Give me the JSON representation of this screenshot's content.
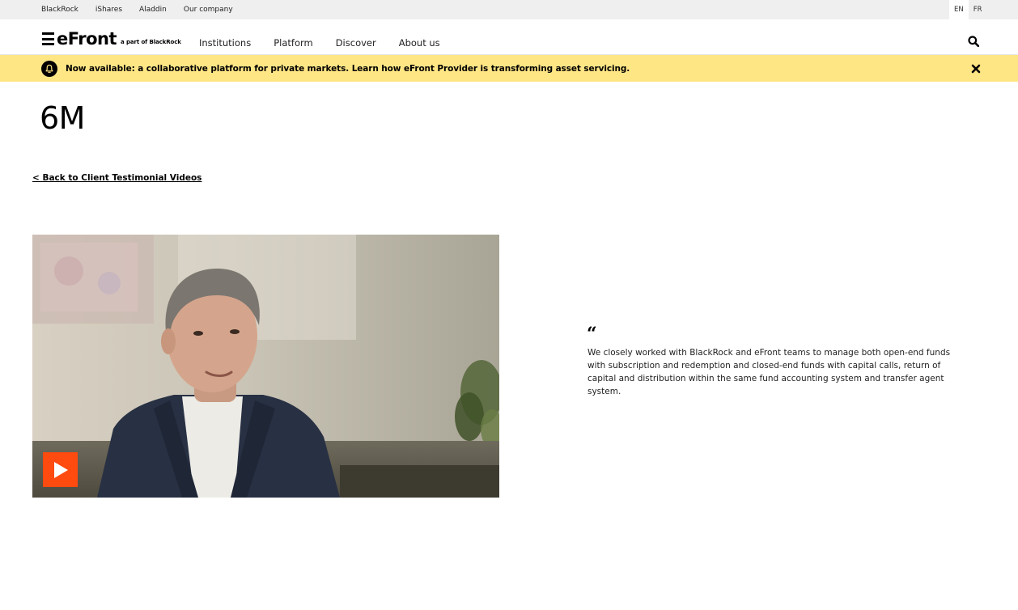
{
  "utility_bar": {
    "links": [
      "BlackRock",
      "iShares",
      "Aladdin",
      "Our company"
    ],
    "languages": [
      "EN",
      "FR"
    ],
    "active_language": "EN"
  },
  "header": {
    "logo_text": "eFront",
    "logo_sub": "a part of BlackRock",
    "nav": [
      "Institutions",
      "Platform",
      "Discover",
      "About us"
    ],
    "search_icon": "search-icon"
  },
  "banner": {
    "icon": "bell-icon",
    "text": "Now available: a collaborative platform for private markets. Learn how eFront Provider is transforming asset servicing.",
    "close_icon": "close-icon"
  },
  "content": {
    "title": "6M",
    "back_link": "< Back to Client Testimonial Videos",
    "video": {
      "play_icon": "play-icon",
      "accent_color": "#ff4a10"
    },
    "quote_mark": "“",
    "quote": "We closely worked with BlackRock and eFront teams to manage both open-end funds with subscription and redemption and closed-end funds with capital calls, return of capital and distribution within the same fund accounting system and transfer agent system."
  },
  "colors": {
    "banner_bg": "#ffe685",
    "utility_bg": "#efefef",
    "play_button": "#ff4a10"
  }
}
